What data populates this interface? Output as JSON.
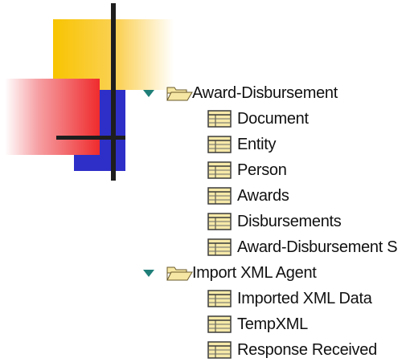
{
  "colors": {
    "deco_yellow": "#f8c400",
    "deco_blue": "#2e2fc8",
    "deco_red": "#ef2b2d",
    "deco_lines": "#1e1e1e",
    "expander_arrow": "#1f7f78",
    "folder_fill": "#f6e7a4",
    "table_icon_fill": "#f6e9a8",
    "text": "#111111"
  },
  "tree": {
    "groups": [
      {
        "label": "Award-Disbursement",
        "icon": "open-folder-icon",
        "expanded": true,
        "items": [
          {
            "label": "Document",
            "icon": "table-icon"
          },
          {
            "label": "Entity",
            "icon": "table-icon"
          },
          {
            "label": "Person",
            "icon": "table-icon"
          },
          {
            "label": "Awards",
            "icon": "table-icon"
          },
          {
            "label": "Disbursements",
            "icon": "table-icon"
          },
          {
            "label": "Award-Disbursement S",
            "icon": "table-icon"
          }
        ]
      },
      {
        "label": "Import XML Agent",
        "icon": "open-folder-icon",
        "expanded": true,
        "items": [
          {
            "label": "Imported XML Data",
            "icon": "table-icon"
          },
          {
            "label": "TempXML",
            "icon": "table-icon"
          },
          {
            "label": "Response Received",
            "icon": "table-icon"
          }
        ]
      }
    ]
  }
}
